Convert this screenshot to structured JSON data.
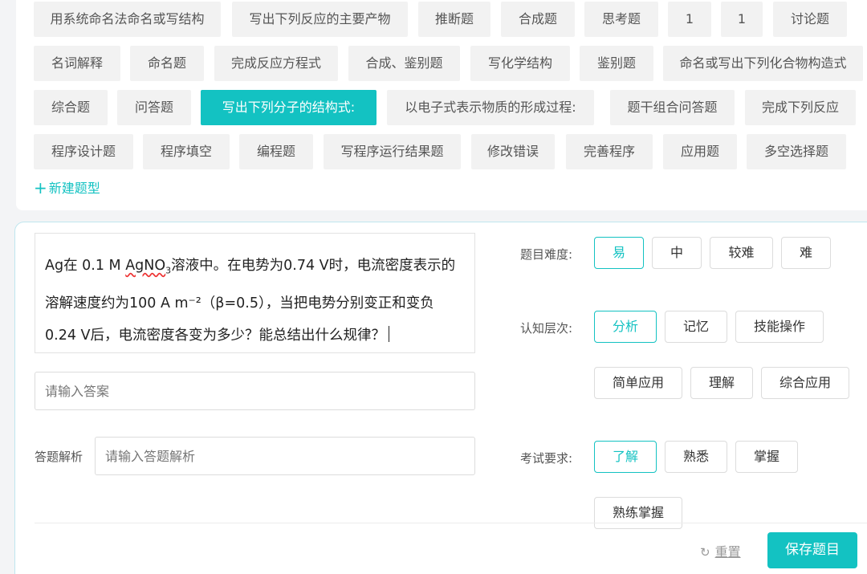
{
  "question_types": {
    "row1": [
      "用系统命名法命名或写结构",
      "写出下列反应的主要产物",
      "推断题",
      "合成题",
      "思考题",
      "1",
      "1",
      "讨论题"
    ],
    "row2": [
      "名词解释",
      "命名题",
      "完成反应方程式",
      "合成、鉴别题",
      "写化学结构",
      "鉴别题",
      "命名或写出下列化合物构造式"
    ],
    "row3": [
      "综合题",
      "问答题",
      "写出下列分子的结构式:",
      "以电子式表示物质的形成过程:",
      "题干组合问答题",
      "完成下列反应"
    ],
    "row4": [
      "程序设计题",
      "程序填空",
      "编程题",
      "写程序运行结果题",
      "修改错误",
      "完善程序",
      "应用题",
      "多空选择题"
    ],
    "active": "写出下列分子的结构式:",
    "new_type_label": "新建题型"
  },
  "question": {
    "line1_a": "Ag在 0.1 M ",
    "line1_wavy": "AgNO",
    "line1_sub": "3",
    "line1_b": "溶液中。在电势为0.74 V时，电流密度表示的",
    "line2": "溶解速度约为100 A m⁻²（β=0.5），当把电势分别变正和变负",
    "line3": "0.24 V后，电流密度各变为多少？能总结出什么规律？"
  },
  "answer": {
    "placeholder": "请输入答案"
  },
  "analysis": {
    "label": "答题解析",
    "placeholder": "请输入答题解析"
  },
  "difficulty": {
    "label": "题目难度:",
    "options": [
      "易",
      "中",
      "较难",
      "难"
    ],
    "selected": "易"
  },
  "cognitive": {
    "label": "认知层次:",
    "options": [
      "分析",
      "记忆",
      "技能操作",
      "简单应用",
      "理解",
      "综合应用"
    ],
    "selected": "分析"
  },
  "exam": {
    "label": "考试要求:",
    "options": [
      "了解",
      "熟悉",
      "掌握",
      "熟练掌握"
    ],
    "selected": "了解"
  },
  "footer": {
    "reset_label": "重置",
    "save_label": "保存题目"
  },
  "colors": {
    "accent": "#13c2c2",
    "tag_bg": "#f2f2f2"
  },
  "icons": {
    "reset": "refresh-icon",
    "add": "plus-icon"
  }
}
